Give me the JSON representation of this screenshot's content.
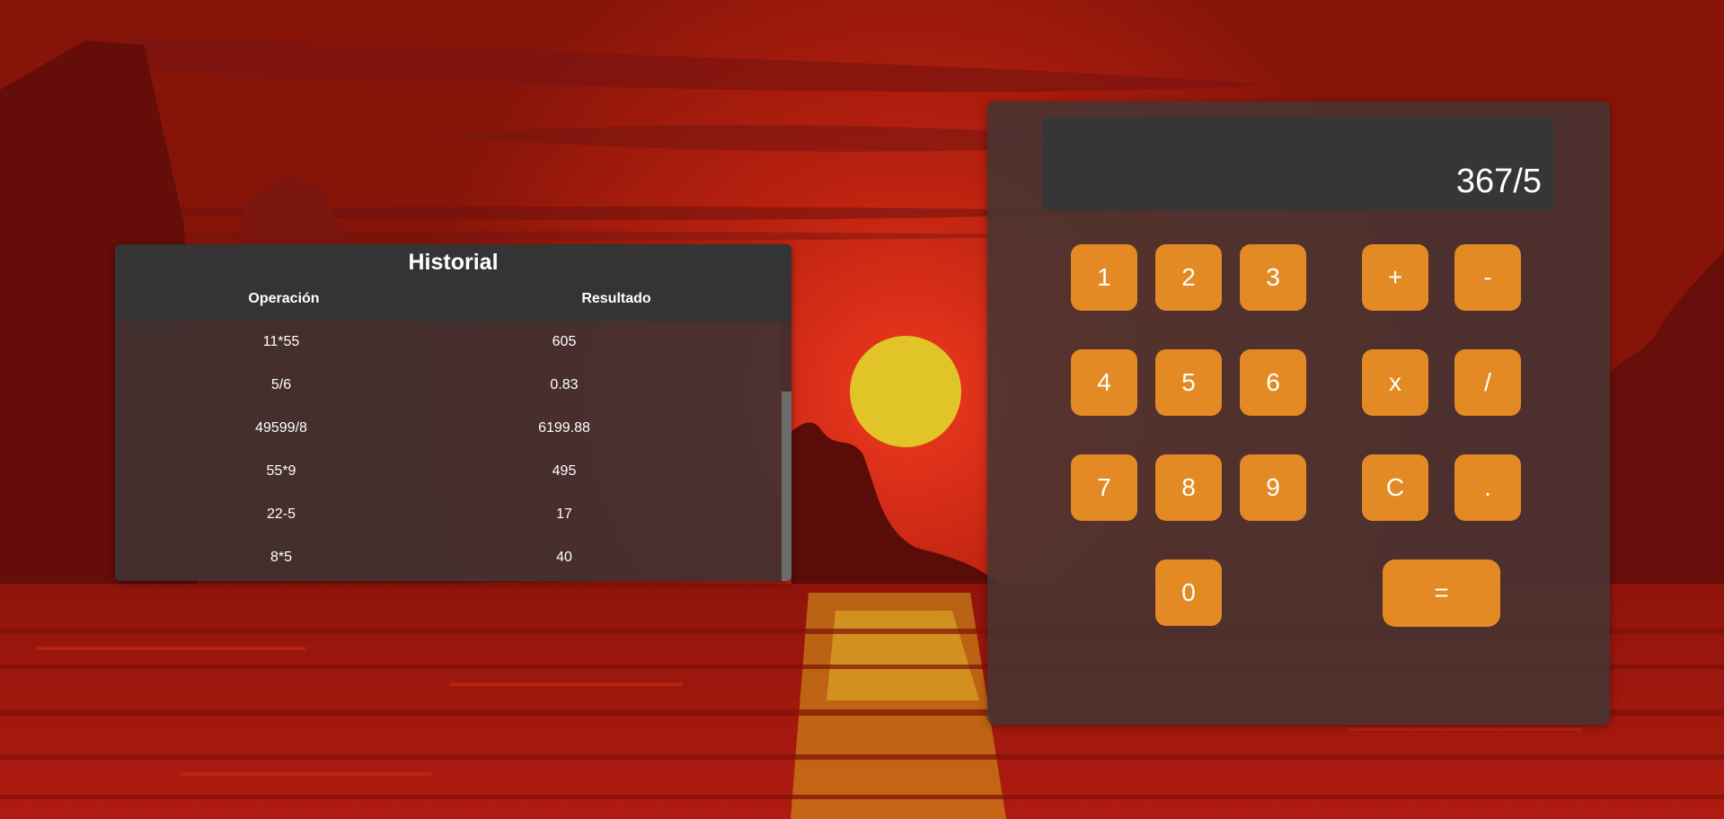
{
  "history": {
    "title": "Historial",
    "columns": {
      "operation": "Operación",
      "result": "Resultado"
    },
    "rows": [
      {
        "operation": "11*55",
        "result": "605"
      },
      {
        "operation": "5/6",
        "result": "0.83"
      },
      {
        "operation": "49599/8",
        "result": "6199.88"
      },
      {
        "operation": "55*9",
        "result": "495"
      },
      {
        "operation": "22-5",
        "result": "17"
      },
      {
        "operation": "8*5",
        "result": "40"
      }
    ]
  },
  "calculator": {
    "display": "367/5",
    "keys": {
      "k1": "1",
      "k2": "2",
      "k3": "3",
      "plus": "+",
      "minus": "-",
      "k4": "4",
      "k5": "5",
      "k6": "6",
      "multiply": "x",
      "divide": "/",
      "k7": "7",
      "k8": "8",
      "k9": "9",
      "clear": "C",
      "decimal": ".",
      "k0": "0",
      "equals": "="
    }
  },
  "colors": {
    "accent": "#e38a24",
    "display_bg": "#363636",
    "sky": "#8c1a0e",
    "sun": "#e0c428"
  }
}
